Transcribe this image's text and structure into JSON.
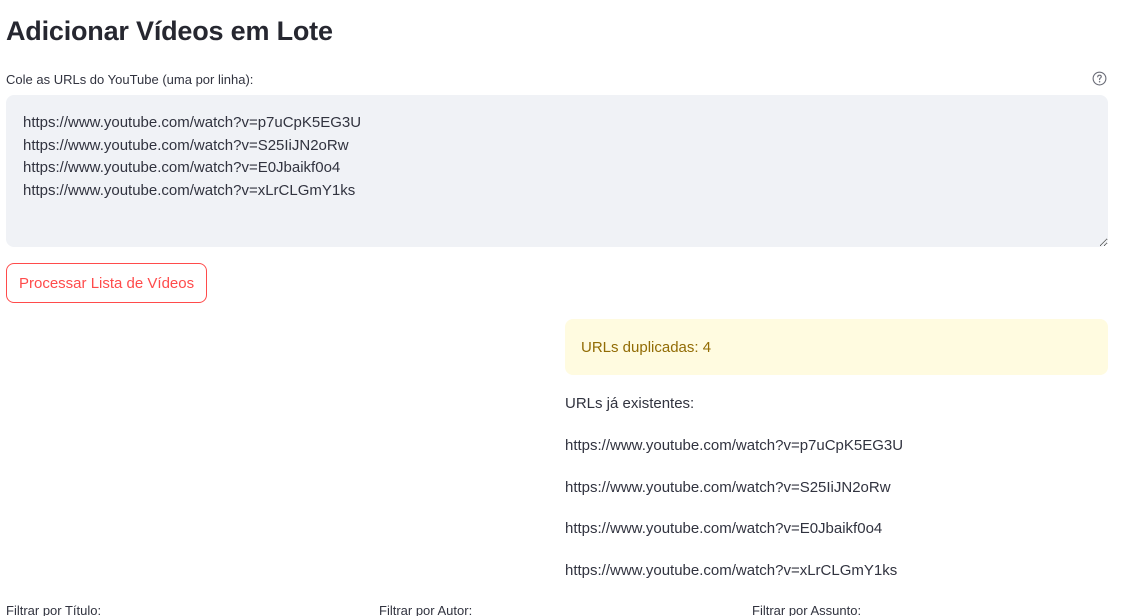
{
  "page": {
    "title": "Adicionar Vídeos em Lote"
  },
  "input": {
    "label": "Cole as URLs do YouTube (uma por linha):",
    "value": "https://www.youtube.com/watch?v=p7uCpK5EG3U\nhttps://www.youtube.com/watch?v=S25IiJN2oRw\nhttps://www.youtube.com/watch?v=E0Jbaikf0o4\nhttps://www.youtube.com/watch?v=xLrCLGmY1ks",
    "help_icon": "question-circle-icon"
  },
  "actions": {
    "process_label": "Processar Lista de Vídeos"
  },
  "results": {
    "warning": "URLs duplicadas: 4",
    "existing_title": "URLs já existentes:",
    "existing_urls": [
      "https://www.youtube.com/watch?v=p7uCpK5EG3U",
      "https://www.youtube.com/watch?v=S25IiJN2oRw",
      "https://www.youtube.com/watch?v=E0Jbaikf0o4",
      "https://www.youtube.com/watch?v=xLrCLGmY1ks"
    ]
  },
  "filters": {
    "title_label": "Filtrar por Título:",
    "author_label": "Filtrar por Autor:",
    "subject_label": "Filtrar por Assunto:"
  },
  "colors": {
    "primary": "#ff4b4b",
    "warning_bg": "#fffbe0",
    "warning_text": "#926c05",
    "input_bg": "#f0f2f6"
  }
}
